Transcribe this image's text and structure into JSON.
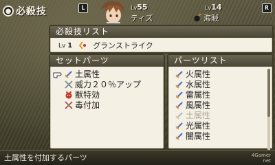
{
  "header": {
    "title": "必殺技",
    "title_icon": "circle-badge-icon",
    "shoulder_left": "L",
    "shoulder_right": "R"
  },
  "characters": [
    {
      "lv_label": "Lv",
      "level": "55",
      "name": "ティズ"
    },
    {
      "lv_label": "Lv",
      "level": "14",
      "name": "海賊",
      "icon": "bomb-icon"
    }
  ],
  "skill_panel": {
    "title": "必殺技リスト",
    "entry": {
      "lv_label": "Lv",
      "level": "1",
      "icon": "skill-icon",
      "name": "グランストライク"
    }
  },
  "set_parts": {
    "title": "セットパーツ",
    "items": [
      {
        "label": "土属性",
        "icon": "sword-icon",
        "selected": true
      },
      {
        "label": "威力２０％アップ",
        "icon": "crossed-swords-icon"
      },
      {
        "label": "獣特効",
        "icon": "beast-icon"
      },
      {
        "label": "毒付加",
        "icon": "crossed-swords-icon"
      }
    ]
  },
  "parts_list": {
    "title": "パーツリスト",
    "items": [
      {
        "label": "火属性",
        "icon": "sword-icon",
        "disabled": false
      },
      {
        "label": "水属性",
        "icon": "sword-icon",
        "disabled": false
      },
      {
        "label": "雷属性",
        "icon": "sword-icon",
        "disabled": false
      },
      {
        "label": "風属性",
        "icon": "sword-icon",
        "disabled": false
      },
      {
        "label": "土属性",
        "icon": "sword-icon",
        "disabled": true
      },
      {
        "label": "光属性",
        "icon": "sword-icon",
        "disabled": false
      },
      {
        "label": "闇属性",
        "icon": "sword-icon",
        "disabled": false
      }
    ]
  },
  "status": {
    "message": "土属性を付加するパーツ"
  },
  "watermark": {
    "line1": "4Gamer",
    "line2": "net"
  },
  "colors": {
    "panel_bg": "#f4f1e4",
    "panel_header": "#58533f",
    "sword_blade": "#5a6cc4",
    "hilt": "#e39a2c",
    "beast": "#c0392b",
    "disabled_text": "#a7a399"
  }
}
